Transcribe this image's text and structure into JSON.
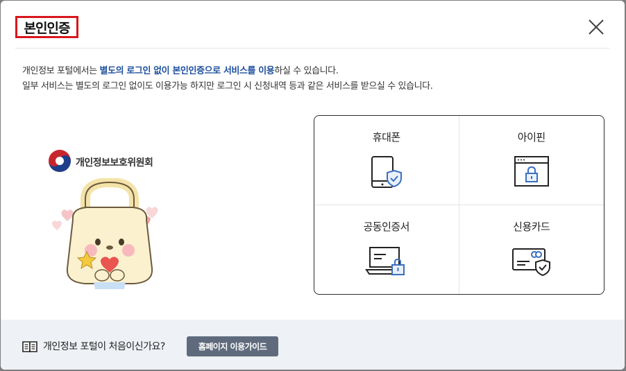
{
  "modal": {
    "title": "본인인증",
    "close_icon": "close-icon"
  },
  "description": {
    "line1_pre": "개인정보 포털에서는 ",
    "line1_highlight": "별도의 로그인 없이 본인인증으로 서비스를 이용",
    "line1_post": "하실 수 있습니다.",
    "line2": "일부 서비스는 별도의 로그인 없이도 이용가능 하지만 로그인 시 신청내역 등과 같은 서비스를 받으실 수 있습니다."
  },
  "logo": {
    "text": "개인정보보호위원회",
    "icon": "taegeuk-emblem-icon"
  },
  "auth_methods": [
    {
      "label": "휴대폰",
      "icon": "mobile-phone-shield-icon"
    },
    {
      "label": "아이핀",
      "icon": "browser-lock-icon"
    },
    {
      "label": "공동인증서",
      "icon": "laptop-lock-icon"
    },
    {
      "label": "신용카드",
      "icon": "credit-card-shield-icon"
    }
  ],
  "footer": {
    "question": "개인정보 포털이 처음이신가요?",
    "guide_button": "홈페이지 이용가이드",
    "book_icon": "book-icon"
  },
  "colors": {
    "title_border": "#d9161c",
    "highlight_text": "#1c4f9c",
    "button_bg": "#5f6b7d",
    "footer_bg": "#eef1f5",
    "icon_accent": "#3b6fbf"
  }
}
